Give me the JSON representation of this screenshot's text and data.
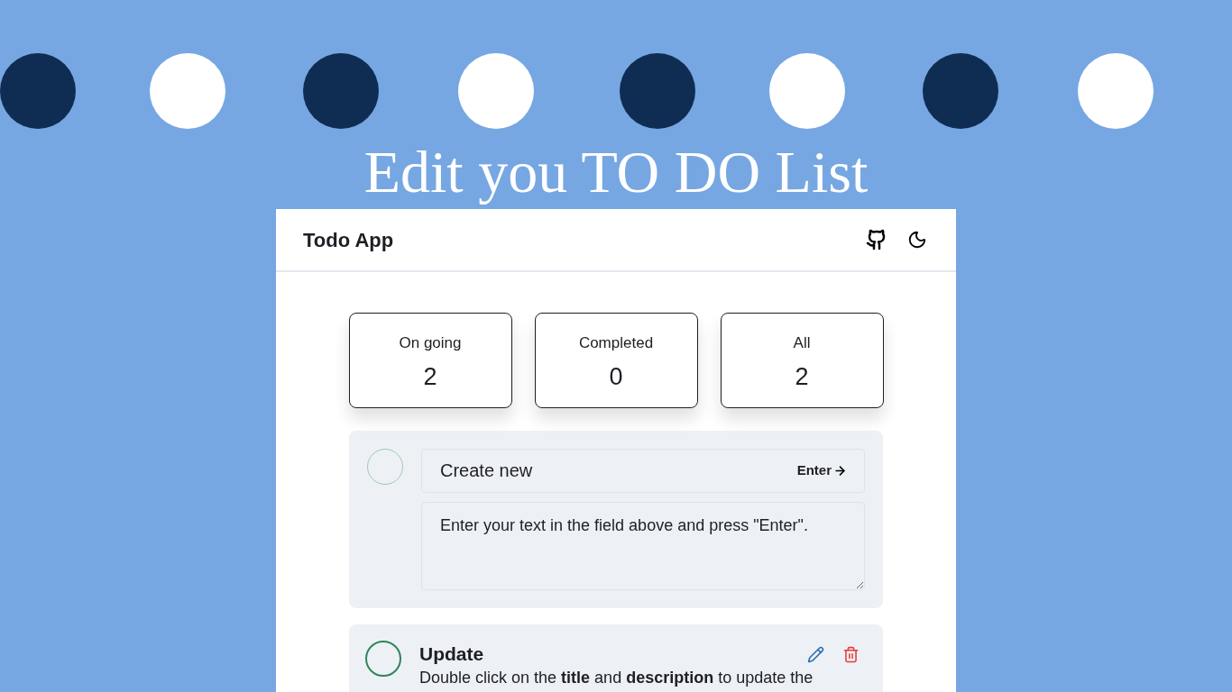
{
  "banner": {
    "title": "Edit you TO DO List"
  },
  "app": {
    "title": "Todo App"
  },
  "stats": [
    {
      "label": "On going",
      "count": "2"
    },
    {
      "label": "Completed",
      "count": "0"
    },
    {
      "label": "All",
      "count": "2"
    }
  ],
  "create": {
    "placeholder": "Create new",
    "hint": "Enter",
    "description_placeholder": "Enter your text in the field above and press \"Enter\"."
  },
  "todos": [
    {
      "title": "Update",
      "description": "Double click on the **title** and **description** to update the",
      "completed": false
    }
  ]
}
